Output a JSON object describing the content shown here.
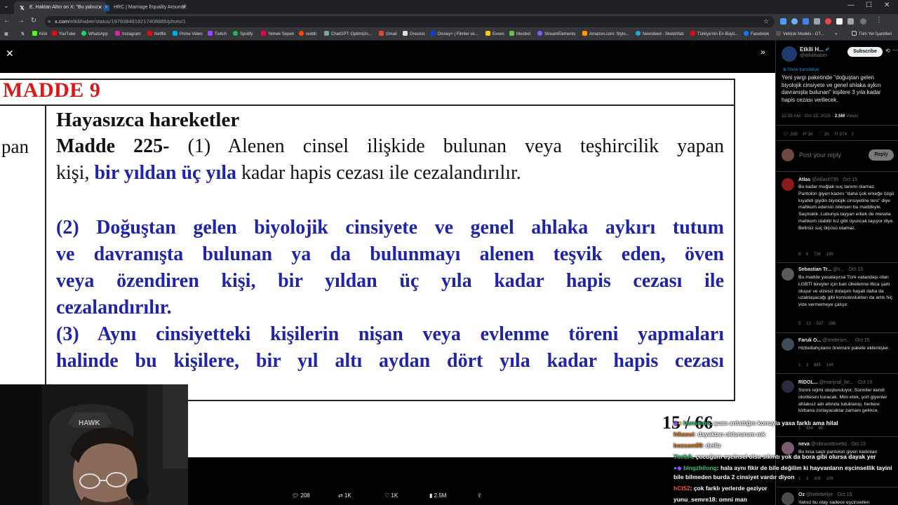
{
  "browser": {
    "tabs": [
      {
        "label": "E. Haktan Altın on X: \"Bu yalnız",
        "icon": "x-icon",
        "active": true
      },
      {
        "label": "HRC | Marriage Equality Around",
        "icon": "hrc-icon",
        "active": false
      }
    ],
    "url_host": "x.com",
    "url_path": "/etkilihaber/status/1978384918217408885/photo/1",
    "bookmarks": [
      "Kick",
      "YouTube",
      "WhatsApp",
      "Instagram",
      "Netflix",
      "Prime Video",
      "Twitch",
      "Spotify",
      "Yemek Sepeti",
      "reddit",
      "ChatGPT: Optimizin...",
      "Gmail",
      "Gnoosic",
      "Disney+ | Filmler ve...",
      "Exxen",
      "Moobot",
      "StreamElements",
      "Amazon.com: Stylo...",
      "Newsfeed - Sketchfab",
      "Türkiye'nin En Büyü...",
      "Facebook",
      "Vehicle Models - GT..."
    ],
    "all_bookmarks": "Tüm Yer İşaretleri"
  },
  "document": {
    "heading": "MADDE 9",
    "left_fragment": "pan",
    "section_title": "Hayasızca hareketler",
    "line1_bold": "Madde 225-",
    "line1_rest": " (1) Alenen cinsel ilişkide bulunan veya teşhircilik yapan",
    "line2_a": "kişi, ",
    "line2_blue": "bir yıldan üç yıla",
    "line2_b": " kadar hapis cezası ile cezalandırılır.",
    "para2_lines": [
      "(2) Doğuştan gelen biyolojik cinsiyete ve genel ahlaka aykırı tutum",
      "ve davranışta bulunan ya da bulunmayı alenen teşvik eden, öven",
      "veya özendiren kişi, bir yıldan üç yıla kadar hapis cezası ile",
      "cezalandırılır."
    ],
    "para3_lines": [
      "(3) Aynı cinsiyetteki kişilerin nişan veya evlenme töreni yapmaları",
      "halinde bu kişilere, bir yıl altı aydan dört yıla kadar hapis cezası"
    ],
    "page_number": "15 / 66"
  },
  "actions": {
    "replies": "208",
    "reposts": "1K",
    "likes": "1K",
    "views": "2.5M"
  },
  "tweet": {
    "author": "Etkili H...",
    "handle": "@etkilihaber",
    "subscribe": "Subscribe",
    "show_translation": "Show translation",
    "text": "Yeni yargı paketinde \"doğuştan gelen biyolojik cinsiyete ve genel ahlaka aykırı davranışta bulunan\" kişilere 3 yıla kadar hapis cezası verilecek.",
    "time": "11:58 AM · Oct 15, 2025 · ",
    "views_count": "2.5M",
    "views_label": " Views",
    "stats": {
      "replies": "208",
      "reposts": "1K",
      "likes": "1K",
      "bookmarks": "374"
    },
    "reply_placeholder": "Post your reply",
    "reply_button": "Reply"
  },
  "replies": [
    {
      "name": "Atlas",
      "meta": "@Atlas0735 · Oct 15",
      "text": "Bu kadar muğlak suç tanımı olamaz. Pantolon giyen kadını \"daha çok erkeğe özgü kıyafeti giydin biyolojik cinsiyetine ters\" diye mahkum edersin istersen bu maddeyle. Saçmalık. Lubunya tayyan erkek de mesela mahkum olabilir kız gibi oyuncak taşıyor diye. Belirsiz suç ölçüsü olamaz.",
      "stats": "6   6   734   19K"
    },
    {
      "name": "Sebastian Tr...",
      "meta": "@s... · Oct 15",
      "text": "Bu madde yasalaşırsa Türk vatandaşı olan LGBTİ bireyler için batı ülkelerine iltica şartı oluşur ve vizesiz dolaşım hayali daha da uzaklaşacağı gibi konsoloslukları da artık hiç vize vermemeye çalışır.",
      "stats": "5   12   507   28K"
    },
    {
      "name": "Faruk O...",
      "meta": "@onderom... · Oct 15",
      "text": "Hizbullahçıların önerisini pakete eklemişler.",
      "stats": "1   3   885   14K"
    },
    {
      "name": "RİDOL...",
      "meta": "@marijnal_be... · Oct 15",
      "text": "Sünni rejimi oluşturuluyor. Sünniler kendi otoritesini kuracak. Mini etek, şort giyenler ahlaksız adı altında tutuklanıp, herkesi türbana zorlayacaklar zamanı gelince.",
      "stats": "1   884   8K"
    },
    {
      "name": "neva",
      "meta": "@vibrantdove6q · Oct 15",
      "text": "Bu kısa saçlı pantolon giyen kadınları",
      "stats": "1   3   306   10K"
    },
    {
      "name": "Oz",
      "meta": "@belebeliye · Oct 15",
      "text": "Yalnız bu olay sadece eşcinsellerı",
      "stats": ""
    }
  ],
  "chat": [
    {
      "user": "hunsinnn",
      "msg": ": şuan anlattığın konuyla yasa farklı ama hilal",
      "color": "#2ecc71"
    },
    {
      "user": "hikasui",
      "msg": ": dayaktan oldururum mk",
      "color": "#e67e22"
    },
    {
      "user": "bozsam89",
      "msg": ": deiliz",
      "color": "#e67e22"
    },
    {
      "user": "YoebA",
      "msg": ": çocuğum eşcinsel olsa sıkıntı yok da bora gibi olursa dayak yer",
      "color": "#2ecc71"
    },
    {
      "user": "bingzhilong",
      "msg": ": hala aynı fikir de bile değilim ki hayvanların eşcinsellik tayini",
      "color": "#2ecc71"
    },
    {
      "user": "",
      "msg": "bile bilmeden burda 2 cinsiyet vardır diyon",
      "color": "#ffffff"
    },
    {
      "user": "hCt52",
      "msg": ": çok farklı yerlerde geziyor",
      "color": "#ff4d4d"
    },
    {
      "user": "yunu_semre18",
      "msg": ": omni man",
      "color": "#ffffff"
    }
  ],
  "webcam": {
    "chair_brand": "HAWK"
  },
  "colors": {
    "doc_red": "#d81919",
    "doc_blue": "#1f24a8",
    "x_bg": "#000000",
    "reply_btn": "#eff3f4",
    "verified": "#1d9bf0"
  }
}
